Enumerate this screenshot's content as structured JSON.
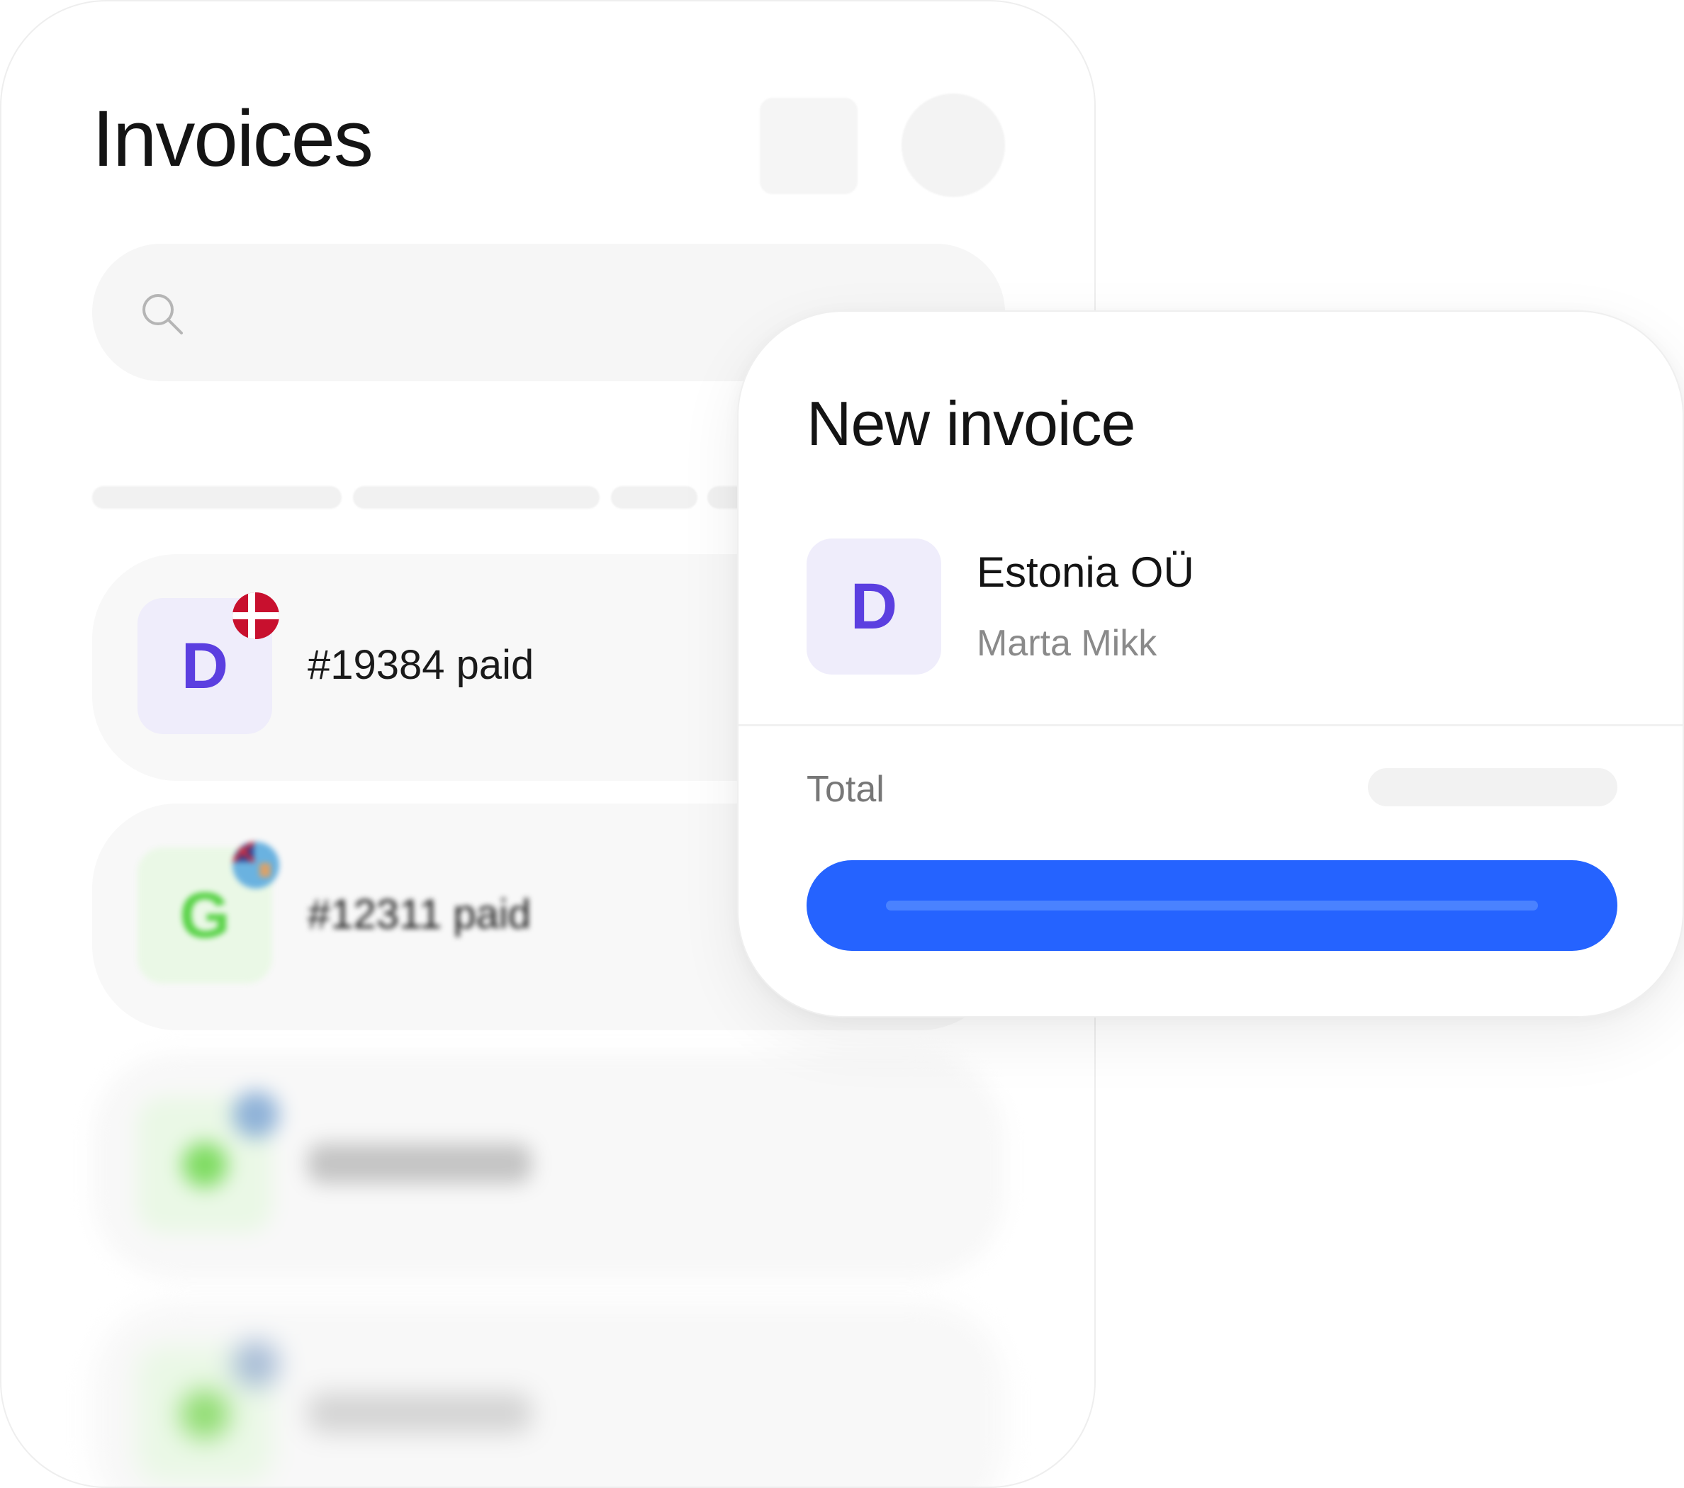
{
  "invoices_screen": {
    "title": "Invoices",
    "rows": [
      {
        "avatar_letter": "D",
        "flag": "denmark-flag",
        "text": "#19384 paid"
      },
      {
        "avatar_letter": "G",
        "flag": "fiji-flag",
        "text": "#12311 paid"
      }
    ]
  },
  "new_invoice": {
    "title": "New invoice",
    "customer": {
      "avatar_letter": "D",
      "company": "Estonia OÜ",
      "contact": "Marta Mikk"
    },
    "total_label": "Total"
  },
  "colors": {
    "accent_blue": "#2563ff",
    "avatar_purple": "#5b3fe0",
    "avatar_green": "#5bd34a",
    "denmark_red": "#c8102e"
  }
}
